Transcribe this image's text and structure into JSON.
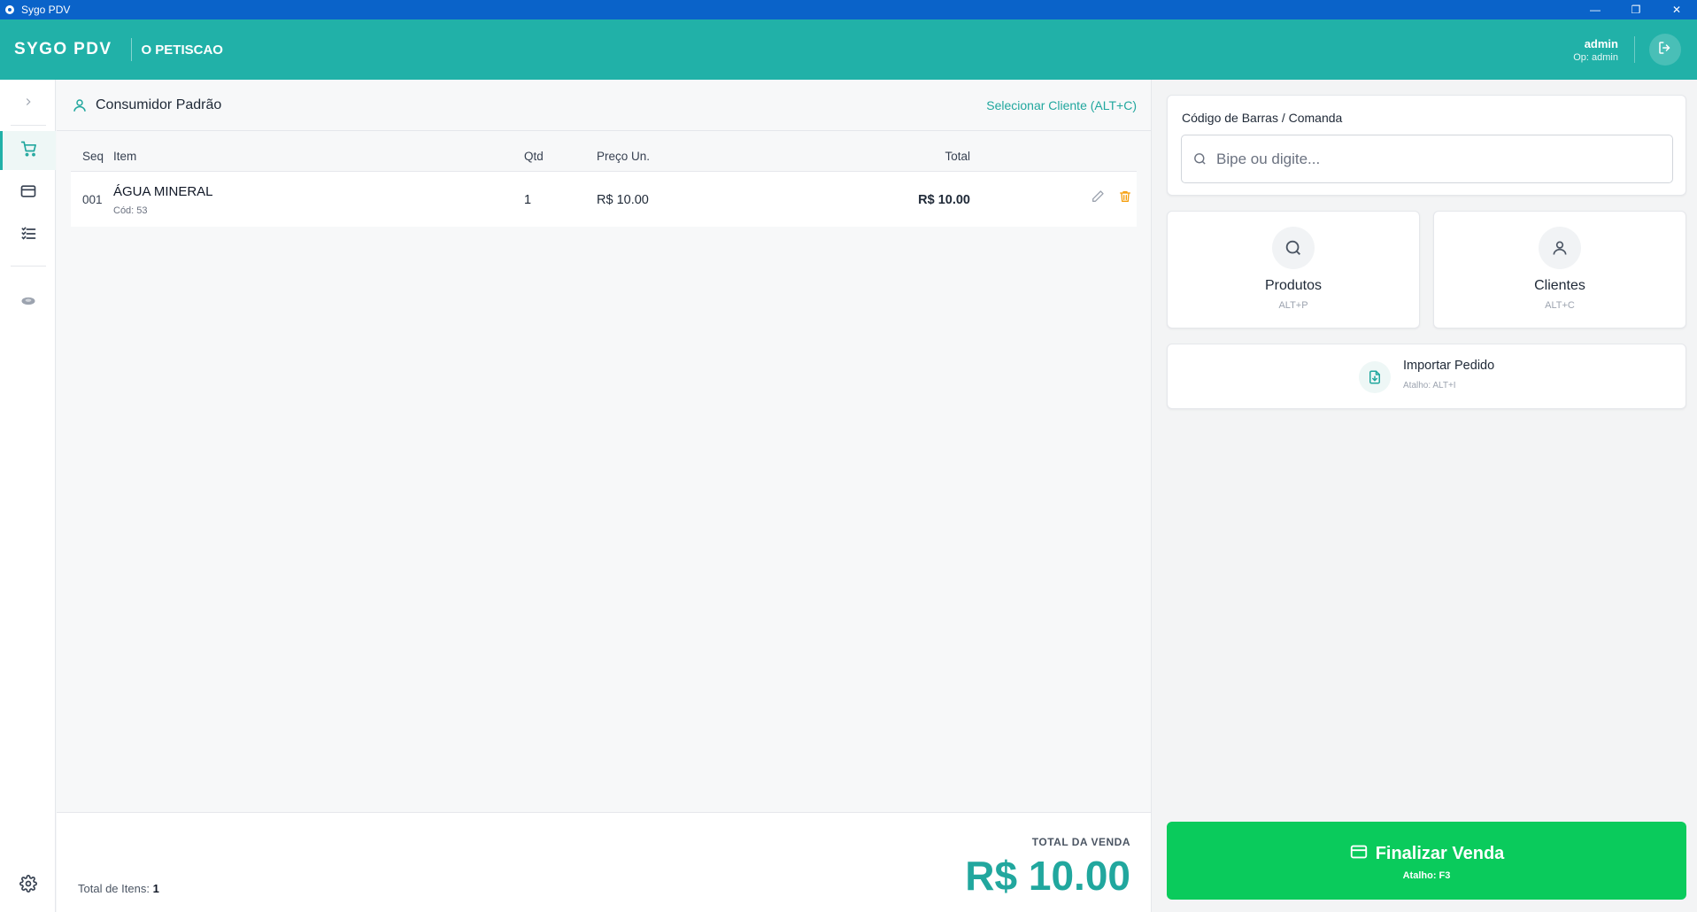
{
  "window": {
    "title": "Sygo PDV",
    "minimize": "—",
    "maximize": "❐",
    "close": "✕"
  },
  "header": {
    "brand": "SYGO PDV",
    "store": "O PETISCAO",
    "user": "admin",
    "operator": "Op: admin"
  },
  "customer": {
    "name": "Consumidor Padrão",
    "select_label": "Selecionar Cliente (ALT+C)"
  },
  "table": {
    "columns": {
      "seq": "Seq",
      "item": "Item",
      "qty": "Qtd",
      "price": "Preço Un.",
      "total": "Total"
    },
    "rows": [
      {
        "seq": "001",
        "name": "ÁGUA MINERAL",
        "code": "Cód: 53",
        "qty": "1",
        "price": "R$ 10.00",
        "total": "R$ 10.00"
      }
    ]
  },
  "footer": {
    "items_label": "Total de Itens:",
    "items_count": "1",
    "total_label": "TOTAL DA VENDA",
    "total_value": "R$ 10.00"
  },
  "barcode": {
    "label": "Código de Barras / Comanda",
    "placeholder": "Bipe ou digite..."
  },
  "actions": {
    "products": {
      "label": "Produtos",
      "shortcut": "ALT+P"
    },
    "clients": {
      "label": "Clientes",
      "shortcut": "ALT+C"
    },
    "import": {
      "label": "Importar Pedido",
      "shortcut": "Atalho: ALT+I"
    }
  },
  "finalize": {
    "label": "Finalizar Venda",
    "shortcut": "Atalho: F3"
  },
  "colors": {
    "primary": "#21b1a8",
    "accent": "#21a79e",
    "finalize": "#0acb5c",
    "titlebar": "#0a63c9",
    "delete": "#f59e0b"
  }
}
